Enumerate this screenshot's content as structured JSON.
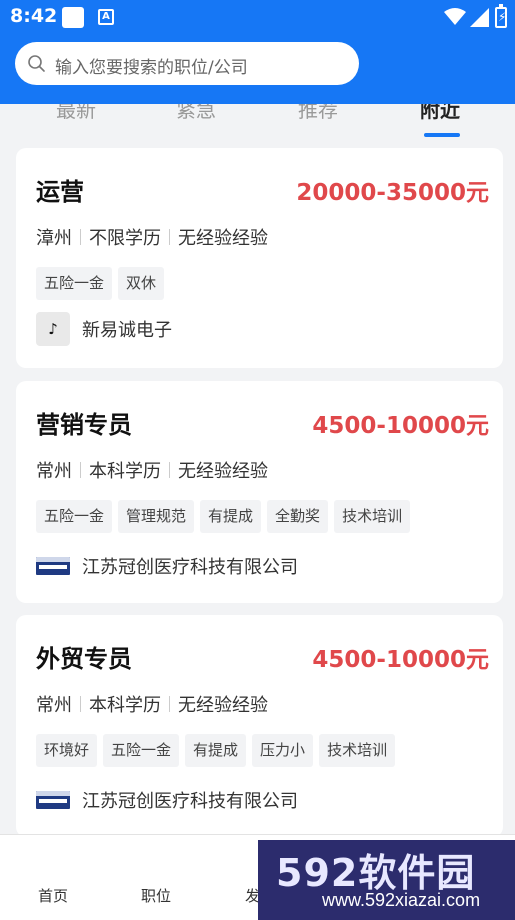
{
  "status_bar": {
    "time": "8:42",
    "notif_badge": "A"
  },
  "search": {
    "placeholder": "输入您要搜索的职位/公司"
  },
  "tabs": [
    {
      "label": "最新"
    },
    {
      "label": "紧急"
    },
    {
      "label": "推荐"
    },
    {
      "label": "附近",
      "active": true
    }
  ],
  "jobs": [
    {
      "title": "运营",
      "salary": "20000-35000元",
      "location": "漳州",
      "education": "不限学历",
      "experience": "无经验经验",
      "tags": [
        "五险一金",
        "双休"
      ],
      "company": "新易诚电子",
      "logo_icon": "tiktok-logo-icon",
      "logo_glyph": "♪"
    },
    {
      "title": "营销专员",
      "salary": "4500-10000元",
      "location": "常州",
      "education": "本科学历",
      "experience": "无经验经验",
      "tags": [
        "五险一金",
        "管理规范",
        "有提成",
        "全勤奖",
        "技术培训"
      ],
      "company": "江苏冠创医疗科技有限公司",
      "logo_icon": "guanchu-logo-icon"
    },
    {
      "title": "外贸专员",
      "salary": "4500-10000元",
      "location": "常州",
      "education": "本科学历",
      "experience": "无经验经验",
      "tags": [
        "环境好",
        "五险一金",
        "有提成",
        "压力小",
        "技术培训"
      ],
      "company": "江苏冠创医疗科技有限公司",
      "logo_icon": "guanchu-logo-icon"
    }
  ],
  "bottom_nav": [
    {
      "label": "首页"
    },
    {
      "label": "职位"
    },
    {
      "label": "发"
    }
  ],
  "watermark": {
    "logo": "592软件园",
    "url": "www.592xiazai.com"
  },
  "colors": {
    "primary": "#1677f5",
    "salary": "#e0484b"
  }
}
